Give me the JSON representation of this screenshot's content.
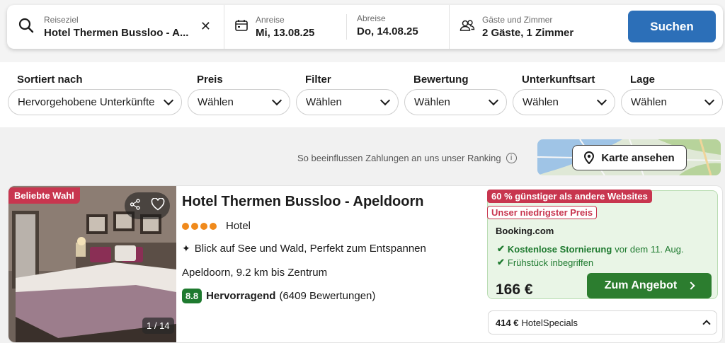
{
  "search": {
    "destination_label": "Reiseziel",
    "destination_value": "Hotel Thermen Bussloo - A...",
    "checkin_label": "Anreise",
    "checkin_value": "Mi, 13.08.25",
    "checkout_label": "Abreise",
    "checkout_value": "Do, 14.08.25",
    "guests_label": "Gäste und Zimmer",
    "guests_value": "2 Gäste, 1 Zimmer",
    "search_button": "Suchen"
  },
  "filters": [
    {
      "title": "Sortiert nach",
      "value": "Hervorgehobene Unterkünfte"
    },
    {
      "title": "Preis",
      "value": "Wählen"
    },
    {
      "title": "Filter",
      "value": "Wählen"
    },
    {
      "title": "Bewertung",
      "value": "Wählen"
    },
    {
      "title": "Unterkunftsart",
      "value": "Wählen"
    },
    {
      "title": "Lage",
      "value": "Wählen"
    }
  ],
  "ranking_note": "So beeinflussen Zahlungen an uns unser Ranking",
  "map_button": "Karte ansehen",
  "hotel": {
    "badge": "Beliebte Wahl",
    "photo_counter": "1 / 14",
    "name": "Hotel Thermen Bussloo - Apeldoorn",
    "stars": 4,
    "type": "Hotel",
    "highlights": "Blick auf See und Wald, Perfekt zum Entspannen",
    "location": "Apeldoorn, 9.2 km bis Zentrum",
    "score": "8.8",
    "score_word": "Hervorragend",
    "reviews": "(6409 Bewertungen)",
    "deal": {
      "tag_cheaper": "60 % günstiger als andere Websites",
      "tag_lowest": "Unser niedrigster Preis",
      "provider": "Booking.com",
      "perk1_strong": "Kostenlose Stornierung",
      "perk1_rest": "vor dem 11. Aug.",
      "perk2": "Frühstück inbegriffen",
      "price": "166 €",
      "button": "Zum Angebot"
    },
    "specials_price": "414 €",
    "specials_label": "HotelSpecials"
  },
  "colors": {
    "brand_blue": "#2c6fb8",
    "offer_green": "#2c7d2f",
    "rating_green": "#1e7a2f",
    "badge_red": "#c8364f",
    "star_orange": "#f08a1c"
  }
}
